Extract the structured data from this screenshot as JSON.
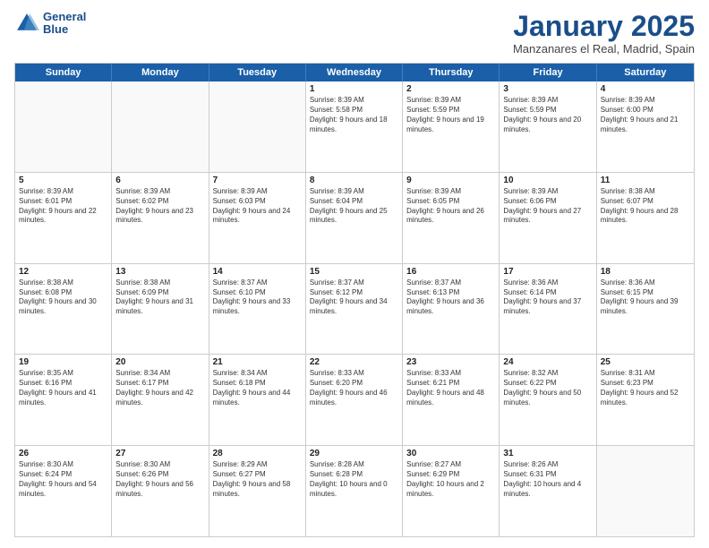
{
  "header": {
    "logo_line1": "General",
    "logo_line2": "Blue",
    "month_title": "January 2025",
    "location": "Manzanares el Real, Madrid, Spain"
  },
  "days_of_week": [
    "Sunday",
    "Monday",
    "Tuesday",
    "Wednesday",
    "Thursday",
    "Friday",
    "Saturday"
  ],
  "rows": [
    {
      "cells": [
        {
          "empty": true
        },
        {
          "empty": true
        },
        {
          "empty": true
        },
        {
          "day": "1",
          "sunrise": "8:39 AM",
          "sunset": "5:58 PM",
          "daylight": "9 hours and 18 minutes."
        },
        {
          "day": "2",
          "sunrise": "8:39 AM",
          "sunset": "5:59 PM",
          "daylight": "9 hours and 19 minutes."
        },
        {
          "day": "3",
          "sunrise": "8:39 AM",
          "sunset": "5:59 PM",
          "daylight": "9 hours and 20 minutes."
        },
        {
          "day": "4",
          "sunrise": "8:39 AM",
          "sunset": "6:00 PM",
          "daylight": "9 hours and 21 minutes."
        }
      ]
    },
    {
      "cells": [
        {
          "day": "5",
          "sunrise": "8:39 AM",
          "sunset": "6:01 PM",
          "daylight": "9 hours and 22 minutes."
        },
        {
          "day": "6",
          "sunrise": "8:39 AM",
          "sunset": "6:02 PM",
          "daylight": "9 hours and 23 minutes."
        },
        {
          "day": "7",
          "sunrise": "8:39 AM",
          "sunset": "6:03 PM",
          "daylight": "9 hours and 24 minutes."
        },
        {
          "day": "8",
          "sunrise": "8:39 AM",
          "sunset": "6:04 PM",
          "daylight": "9 hours and 25 minutes."
        },
        {
          "day": "9",
          "sunrise": "8:39 AM",
          "sunset": "6:05 PM",
          "daylight": "9 hours and 26 minutes."
        },
        {
          "day": "10",
          "sunrise": "8:39 AM",
          "sunset": "6:06 PM",
          "daylight": "9 hours and 27 minutes."
        },
        {
          "day": "11",
          "sunrise": "8:38 AM",
          "sunset": "6:07 PM",
          "daylight": "9 hours and 28 minutes."
        }
      ]
    },
    {
      "cells": [
        {
          "day": "12",
          "sunrise": "8:38 AM",
          "sunset": "6:08 PM",
          "daylight": "9 hours and 30 minutes."
        },
        {
          "day": "13",
          "sunrise": "8:38 AM",
          "sunset": "6:09 PM",
          "daylight": "9 hours and 31 minutes."
        },
        {
          "day": "14",
          "sunrise": "8:37 AM",
          "sunset": "6:10 PM",
          "daylight": "9 hours and 33 minutes."
        },
        {
          "day": "15",
          "sunrise": "8:37 AM",
          "sunset": "6:12 PM",
          "daylight": "9 hours and 34 minutes."
        },
        {
          "day": "16",
          "sunrise": "8:37 AM",
          "sunset": "6:13 PM",
          "daylight": "9 hours and 36 minutes."
        },
        {
          "day": "17",
          "sunrise": "8:36 AM",
          "sunset": "6:14 PM",
          "daylight": "9 hours and 37 minutes."
        },
        {
          "day": "18",
          "sunrise": "8:36 AM",
          "sunset": "6:15 PM",
          "daylight": "9 hours and 39 minutes."
        }
      ]
    },
    {
      "cells": [
        {
          "day": "19",
          "sunrise": "8:35 AM",
          "sunset": "6:16 PM",
          "daylight": "9 hours and 41 minutes."
        },
        {
          "day": "20",
          "sunrise": "8:34 AM",
          "sunset": "6:17 PM",
          "daylight": "9 hours and 42 minutes."
        },
        {
          "day": "21",
          "sunrise": "8:34 AM",
          "sunset": "6:18 PM",
          "daylight": "9 hours and 44 minutes."
        },
        {
          "day": "22",
          "sunrise": "8:33 AM",
          "sunset": "6:20 PM",
          "daylight": "9 hours and 46 minutes."
        },
        {
          "day": "23",
          "sunrise": "8:33 AM",
          "sunset": "6:21 PM",
          "daylight": "9 hours and 48 minutes."
        },
        {
          "day": "24",
          "sunrise": "8:32 AM",
          "sunset": "6:22 PM",
          "daylight": "9 hours and 50 minutes."
        },
        {
          "day": "25",
          "sunrise": "8:31 AM",
          "sunset": "6:23 PM",
          "daylight": "9 hours and 52 minutes."
        }
      ]
    },
    {
      "cells": [
        {
          "day": "26",
          "sunrise": "8:30 AM",
          "sunset": "6:24 PM",
          "daylight": "9 hours and 54 minutes."
        },
        {
          "day": "27",
          "sunrise": "8:30 AM",
          "sunset": "6:26 PM",
          "daylight": "9 hours and 56 minutes."
        },
        {
          "day": "28",
          "sunrise": "8:29 AM",
          "sunset": "6:27 PM",
          "daylight": "9 hours and 58 minutes."
        },
        {
          "day": "29",
          "sunrise": "8:28 AM",
          "sunset": "6:28 PM",
          "daylight": "10 hours and 0 minutes."
        },
        {
          "day": "30",
          "sunrise": "8:27 AM",
          "sunset": "6:29 PM",
          "daylight": "10 hours and 2 minutes."
        },
        {
          "day": "31",
          "sunrise": "8:26 AM",
          "sunset": "6:31 PM",
          "daylight": "10 hours and 4 minutes."
        },
        {
          "empty": true
        }
      ]
    }
  ]
}
